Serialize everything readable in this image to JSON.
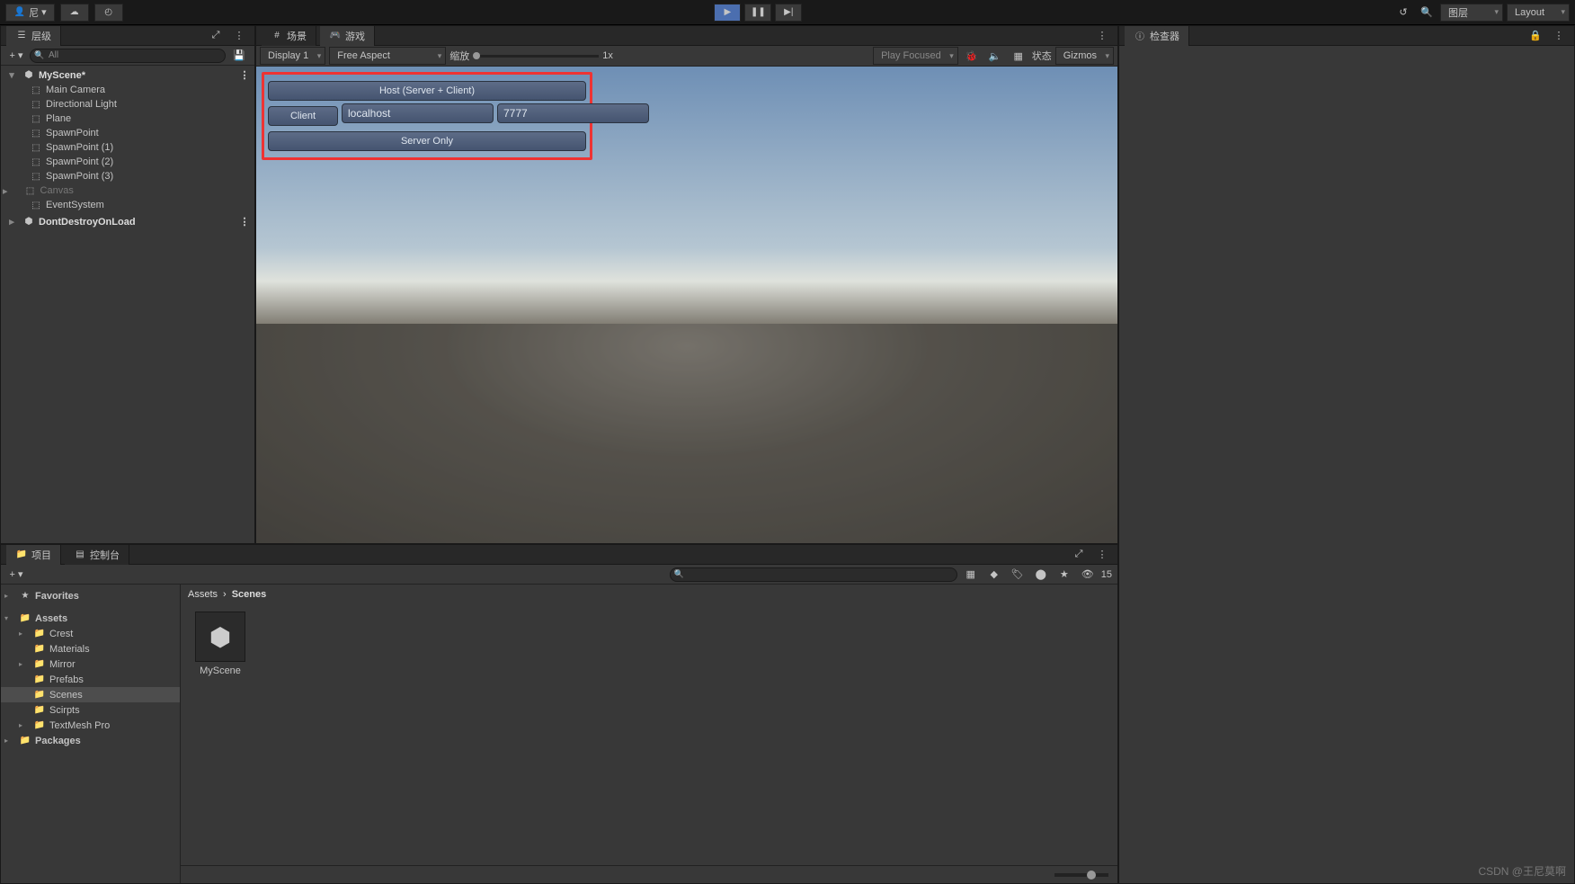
{
  "topbar": {
    "account": "尼",
    "layers_dd": "图层",
    "layout_dd": "Layout"
  },
  "hierarchy": {
    "tab": "层级",
    "search_placeholder": "All",
    "scene": "MyScene*",
    "items": [
      {
        "name": "Main Camera",
        "dim": false
      },
      {
        "name": "Directional Light",
        "dim": false
      },
      {
        "name": "Plane",
        "dim": false
      },
      {
        "name": "SpawnPoint",
        "dim": false
      },
      {
        "name": "SpawnPoint (1)",
        "dim": false
      },
      {
        "name": "SpawnPoint (2)",
        "dim": false
      },
      {
        "name": "SpawnPoint (3)",
        "dim": false
      },
      {
        "name": "Canvas",
        "dim": true
      },
      {
        "name": "EventSystem",
        "dim": false
      }
    ],
    "other_scene": "DontDestroyOnLoad"
  },
  "game": {
    "tab_scene": "场景",
    "tab_game": "游戏",
    "display": "Display 1",
    "aspect": "Free Aspect",
    "scale_label": "缩放",
    "scale_value": "1x",
    "play_focused": "Play Focused",
    "stats": "状态",
    "gizmos": "Gizmos",
    "net_host": "Host (Server + Client)",
    "net_client": "Client",
    "net_host_value": "localhost",
    "net_port_value": "7777",
    "net_server": "Server Only"
  },
  "inspector": {
    "tab": "检查器"
  },
  "project": {
    "tab_project": "项目",
    "tab_console": "控制台",
    "hidden_count": "15",
    "favorites": "Favorites",
    "assets": "Assets",
    "folders": [
      "Crest",
      "Materials",
      "Mirror",
      "Prefabs",
      "Scenes",
      "Scirpts",
      "TextMesh Pro"
    ],
    "packages": "Packages",
    "breadcrumb": [
      "Assets",
      "Scenes"
    ],
    "items": [
      {
        "name": "MyScene"
      }
    ]
  },
  "watermark": "CSDN @王尼莫啊"
}
